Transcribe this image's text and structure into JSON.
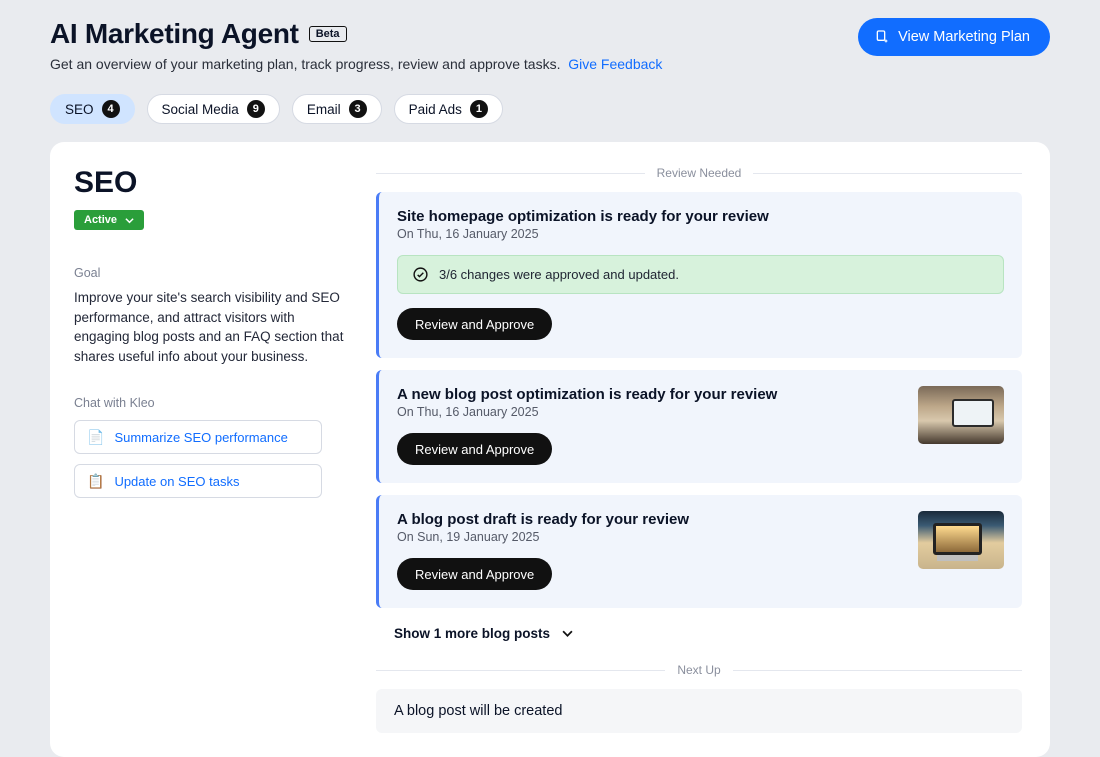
{
  "header": {
    "title": "AI Marketing Agent",
    "beta_badge": "Beta",
    "subtitle": "Get an overview of your marketing plan, track progress, review and approve tasks.",
    "feedback_link": "Give Feedback",
    "view_plan_label": "View Marketing Plan"
  },
  "tabs": [
    {
      "label": "SEO",
      "count": "4",
      "active": true
    },
    {
      "label": "Social Media",
      "count": "9",
      "active": false
    },
    {
      "label": "Email",
      "count": "3",
      "active": false
    },
    {
      "label": "Paid Ads",
      "count": "1",
      "active": false
    }
  ],
  "section": {
    "title": "SEO",
    "status_label": "Active",
    "goal_label": "Goal",
    "goal_text": "Improve your site's search visibility and SEO performance, and attract visitors with engaging blog posts and an FAQ section that shares useful info about your business.",
    "chat_label": "Chat with Kleo",
    "chat_buttons": [
      {
        "emoji": "📄",
        "label": "Summarize SEO performance"
      },
      {
        "emoji": "📋",
        "label": "Update on SEO tasks"
      }
    ]
  },
  "review": {
    "heading": "Review Needed",
    "cards": [
      {
        "title": "Site homepage optimization is ready for your review",
        "date": "On Thu, 16 January 2025",
        "approval_text": "3/6 changes were approved and updated.",
        "button": "Review and Approve",
        "thumb": null
      },
      {
        "title": "A new blog post optimization is ready for your review",
        "date": "On Thu, 16 January 2025",
        "button": "Review and Approve",
        "thumb": "desk"
      },
      {
        "title": "A blog post draft is ready for your review",
        "date": "On Sun, 19 January 2025",
        "button": "Review and Approve",
        "thumb": "laptop"
      }
    ],
    "show_more": "Show 1 more blog posts"
  },
  "nextup": {
    "heading": "Next Up",
    "card_title": "A blog post will be created"
  }
}
